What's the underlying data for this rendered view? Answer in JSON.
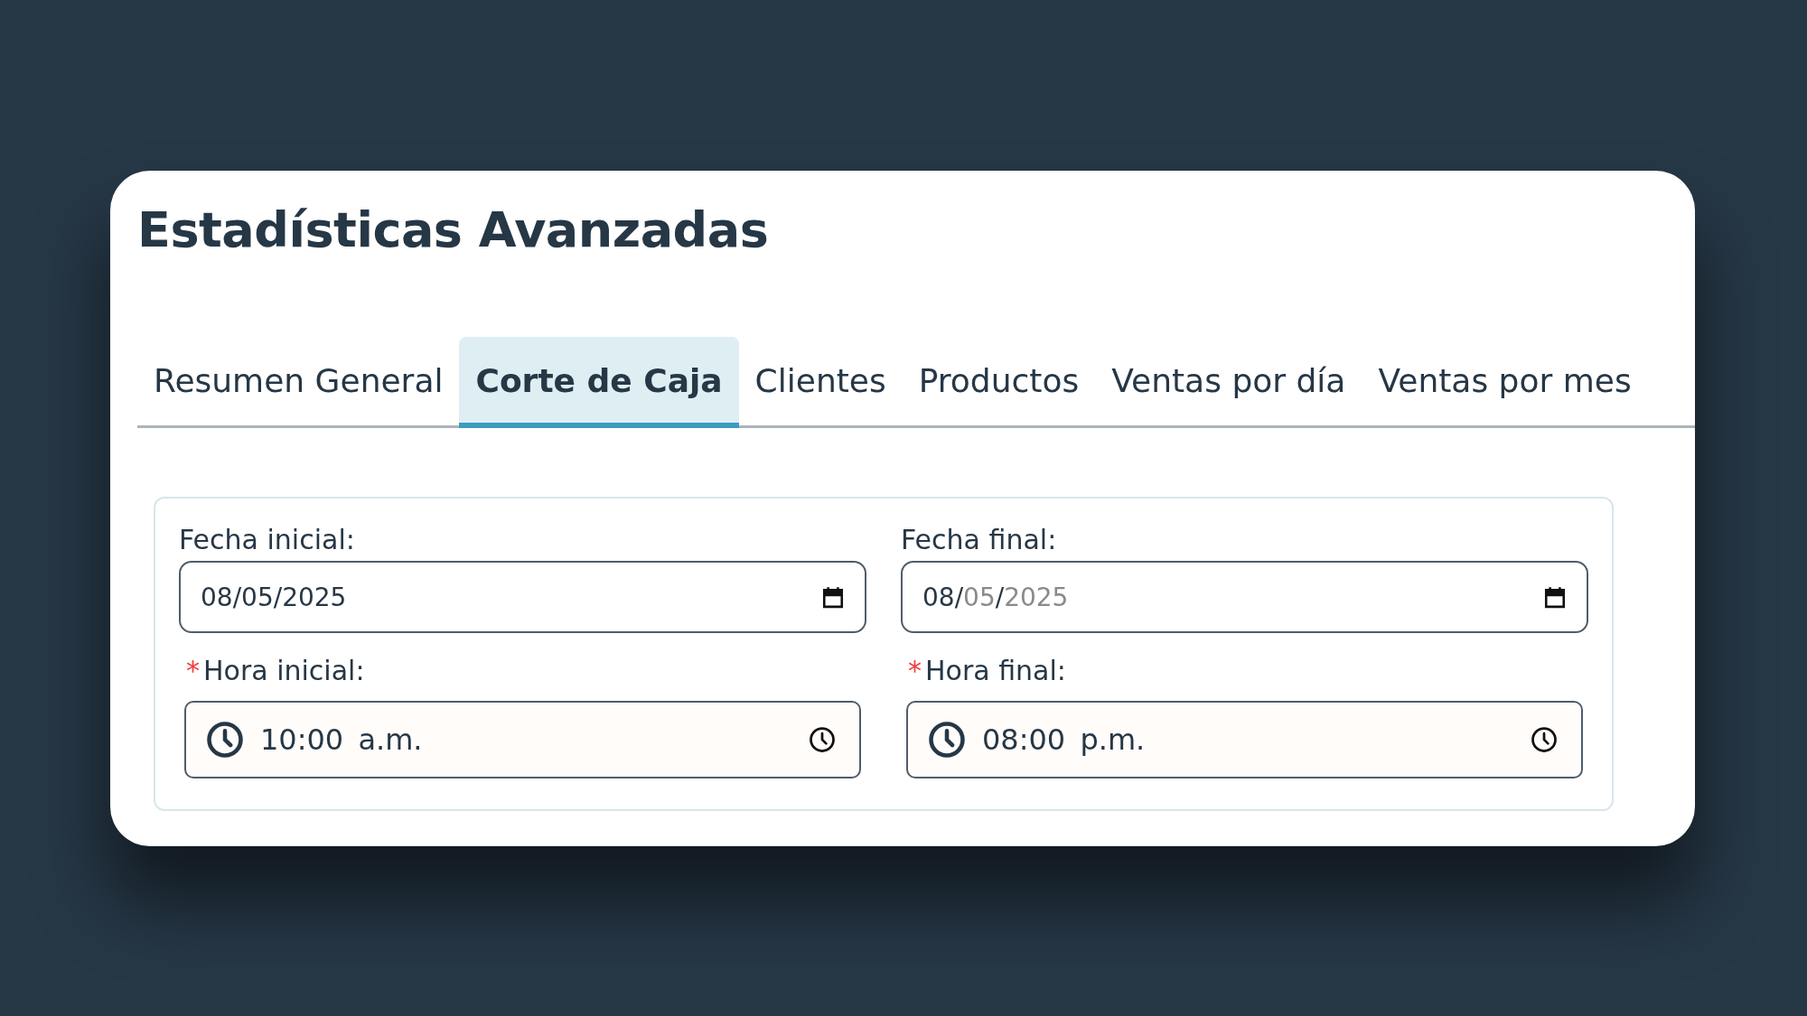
{
  "title": "Estadísticas Avanzadas",
  "tabs": [
    {
      "label": "Resumen General",
      "selected": false
    },
    {
      "label": "Corte de Caja",
      "selected": true
    },
    {
      "label": "Clientes",
      "selected": false
    },
    {
      "label": "Productos",
      "selected": false
    },
    {
      "label": "Ventas por día",
      "selected": false
    },
    {
      "label": "Ventas por mes",
      "selected": false
    }
  ],
  "form": {
    "fields": [
      {
        "kind": "date",
        "label": "Fecha inicial:",
        "segments": [
          {
            "text": "08",
            "dimmed": false
          },
          {
            "text": "/",
            "dimmed": false
          },
          {
            "text": "05",
            "dimmed": false
          },
          {
            "text": "/",
            "dimmed": false
          },
          {
            "text": "2025",
            "dimmed": false
          }
        ]
      },
      {
        "kind": "date",
        "label": "Fecha final:",
        "segments": [
          {
            "text": "08",
            "dimmed": false
          },
          {
            "text": "/",
            "dimmed": false
          },
          {
            "text": "05",
            "dimmed": true
          },
          {
            "text": "/",
            "dimmed": false
          },
          {
            "text": "2025",
            "dimmed": true
          }
        ]
      },
      {
        "kind": "time",
        "label": "Hora inicial:",
        "required_mark": "*",
        "value": "10:00 a.m."
      },
      {
        "kind": "time",
        "label": "Hora final:",
        "required_mark": "*",
        "value": "08:00 p.m."
      }
    ]
  }
}
